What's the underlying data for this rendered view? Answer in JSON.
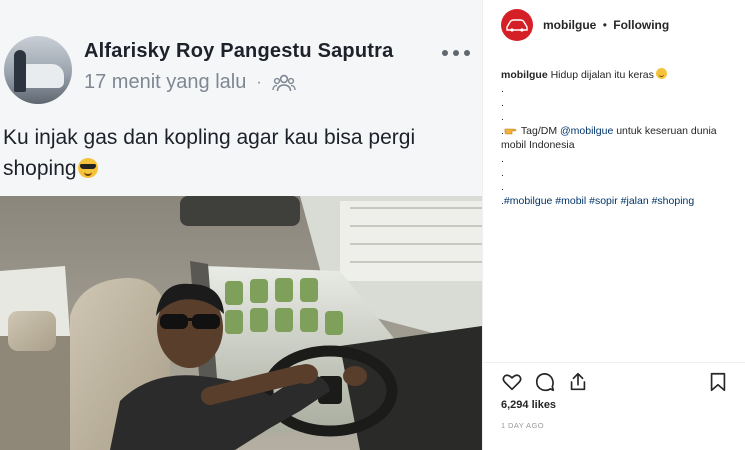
{
  "facebook_post": {
    "author": "Alfarisky Roy Pangestu Saputra",
    "time": "17 menit yang lalu",
    "separator": "·",
    "audience_icon": "friends-icon",
    "more_icon": "more-dots-icon",
    "text": "Ku injak gas dan kopling agar kau bisa pergi shoping"
  },
  "instagram": {
    "account": "mobilgue",
    "separator": "•",
    "follow_state": "Following",
    "avatar_label": "MOBILGUE",
    "caption": {
      "user": "mobilgue",
      "first_line": "Hidup dijalan itu keras",
      "dot": ".",
      "cta_before": "Tag/DM ",
      "cta_mention": "@mobilgue",
      "cta_after": " untuk keseruan dunia mobil Indonesia",
      "hashtags": ".#mobilgue #mobil #sopir #jalan #shoping"
    },
    "actions": [
      "heart-icon",
      "comment-icon",
      "share-icon",
      "bookmark-icon"
    ],
    "likes": "6,294 likes",
    "time": "1 DAY AGO",
    "colors": {
      "brand": "#d51f26",
      "link": "#003569",
      "muted": "#999999"
    }
  }
}
